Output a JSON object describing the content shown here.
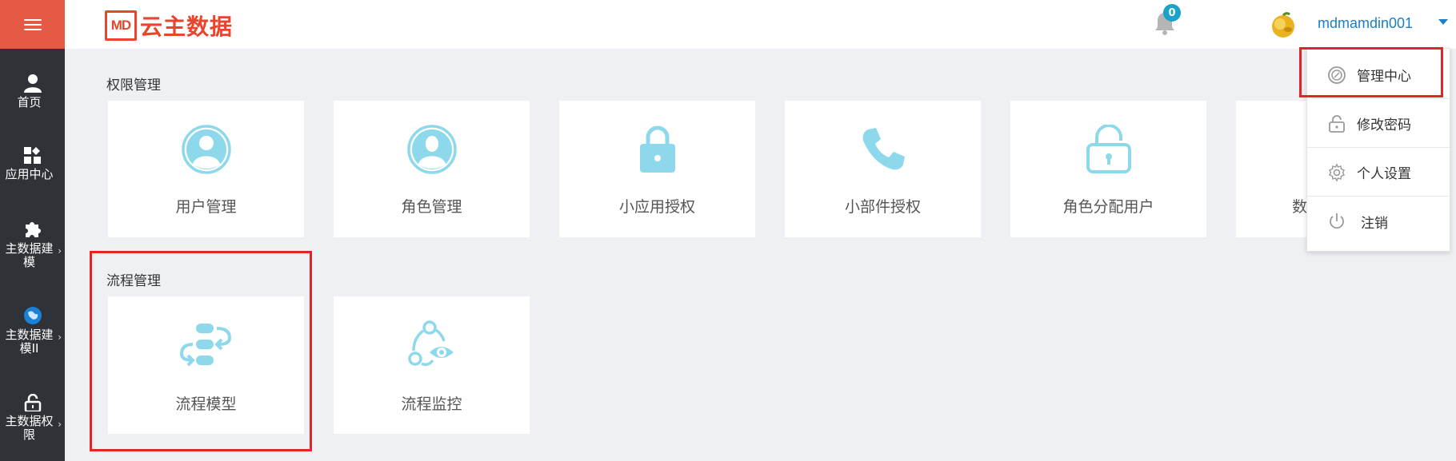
{
  "header": {
    "logo_mark": "MD",
    "logo_text": "云主数据",
    "notification_count": "0",
    "username": "mdmamdin001"
  },
  "sidebar": {
    "items": [
      {
        "label": "首页",
        "icon": "user-icon"
      },
      {
        "label": "应用中心",
        "icon": "apps-icon"
      },
      {
        "label": "主数据建模",
        "icon": "puzzle-icon",
        "expandable": true
      },
      {
        "label": "主数据建模II",
        "icon": "globe-icon",
        "expandable": true
      },
      {
        "label": "主数据权限",
        "icon": "lock-icon",
        "expandable": true
      }
    ]
  },
  "sections": [
    {
      "title": "权限管理",
      "tiles": [
        {
          "label": "用户管理",
          "icon": "user-avatar-icon"
        },
        {
          "label": "角色管理",
          "icon": "role-avatar-icon"
        },
        {
          "label": "小应用授权",
          "icon": "lock-icon"
        },
        {
          "label": "小部件授权",
          "icon": "phone-icon"
        },
        {
          "label": "角色分配用户",
          "icon": "unlock-icon"
        },
        {
          "label": "数",
          "icon": "partially-hidden"
        }
      ]
    },
    {
      "title": "流程管理",
      "tiles": [
        {
          "label": "流程模型",
          "icon": "process-model-icon"
        },
        {
          "label": "流程监控",
          "icon": "process-monitor-icon"
        }
      ]
    }
  ],
  "dropdown": {
    "items": [
      {
        "label": "管理中心",
        "icon": "admin-center-icon",
        "highlighted": true
      },
      {
        "label": "修改密码",
        "icon": "unlock-icon"
      },
      {
        "label": "个人设置",
        "icon": "gear-icon"
      },
      {
        "label": "注销",
        "icon": "power-icon"
      }
    ]
  },
  "colors": {
    "sidebar_bg": "#2f3237",
    "menu_toggle_bg": "#e45a45",
    "brand_red": "#e8452c",
    "icon_blue": "#8ed8ec",
    "link_blue": "#1a7fc4",
    "badge_bg": "#1aa2c8",
    "highlight_red": "#e0252b"
  }
}
